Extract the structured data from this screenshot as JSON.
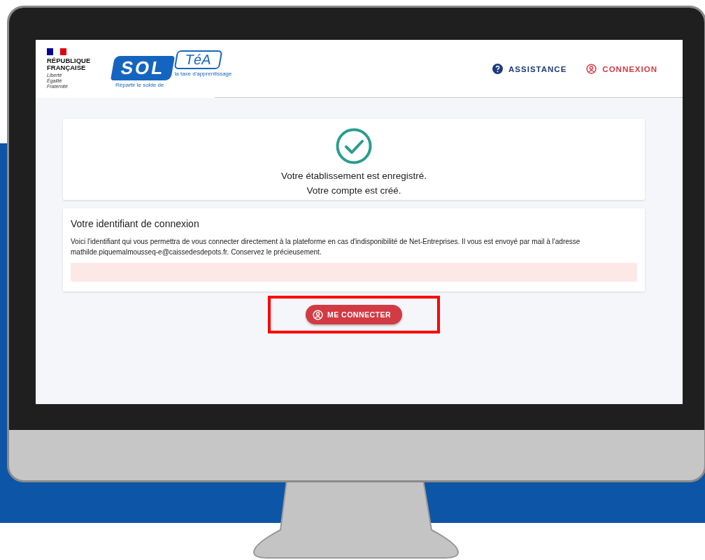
{
  "header": {
    "brand": {
      "lines": [
        "RÉPUBLIQUE",
        "FRANÇAISE"
      ],
      "motto": [
        "Liberté",
        "Égalité",
        "Fraternité"
      ]
    },
    "logo": {
      "left": "SOL",
      "right": "TéA",
      "left_caption": "Répartir le solde de",
      "right_caption": "la taxe d'apprentissage"
    },
    "nav": [
      {
        "label": "ASSISTANCE",
        "kind": "help"
      },
      {
        "label": "CONNEXION",
        "kind": "account"
      }
    ]
  },
  "success": {
    "lines": [
      "Votre établissement est enregistré.",
      "Votre compte est créé."
    ]
  },
  "identifier": {
    "title": "Votre identifiant de connexion",
    "text": "Voici l'identifiant qui vous permettra de vous connecter directement à la plateforme en cas d'indisponibilité de Net-Entreprises. Il vous est envoyé par mail à l'adresse mathilde.piquemalmousseq-e@caissedesdepots.fr. Conservez le précieusement."
  },
  "button": {
    "label": "ME CONNECTER"
  }
}
